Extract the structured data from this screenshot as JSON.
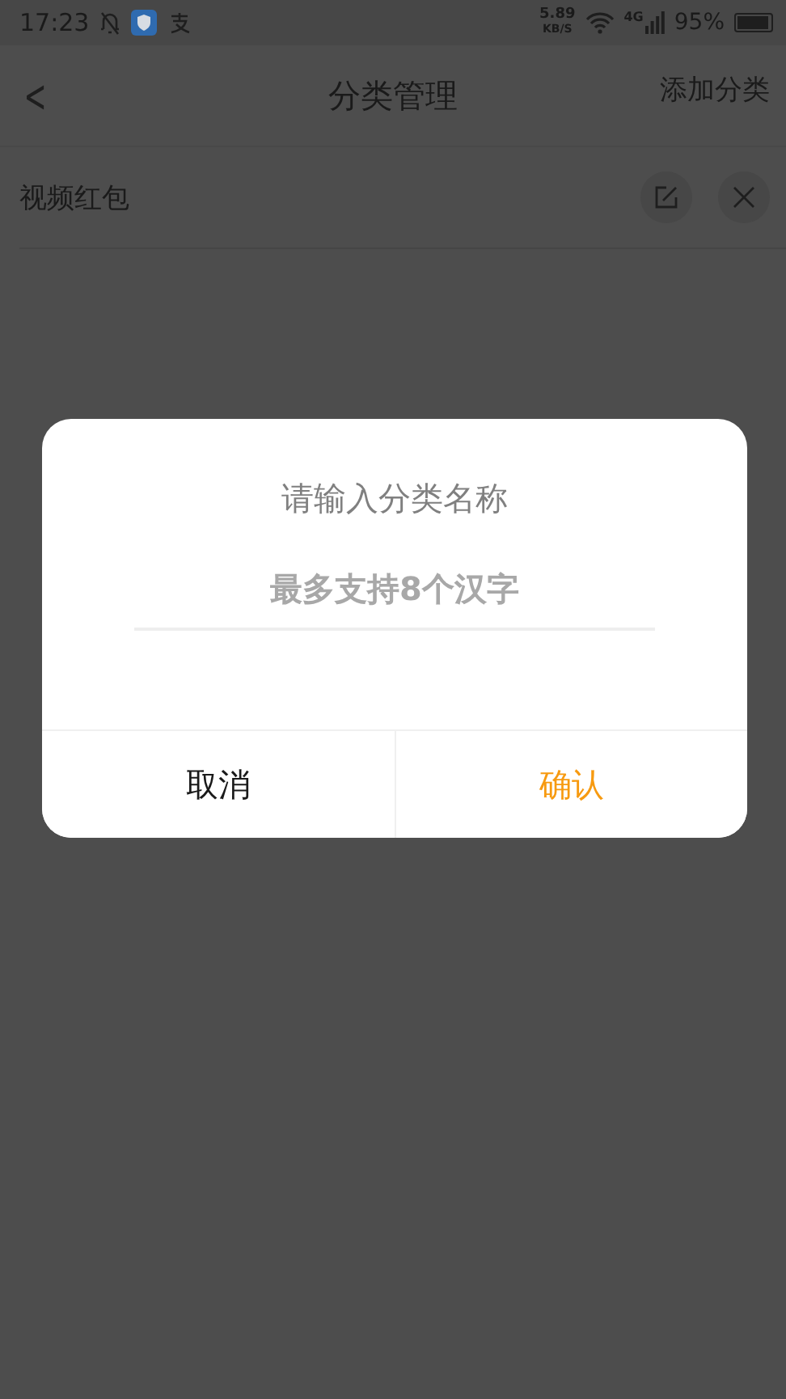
{
  "status_bar": {
    "time": "17:23",
    "speed_value": "5.89",
    "speed_unit": "KB/S",
    "network": "4G",
    "battery": "95%"
  },
  "header": {
    "back": "<",
    "title": "分类管理",
    "action": "添加分类"
  },
  "categories": [
    {
      "name": "视频红包"
    }
  ],
  "dialog": {
    "title": "请输入分类名称",
    "placeholder": "最多支持8个汉字",
    "buttons": [
      {
        "label": "取消",
        "kind": "cancel"
      },
      {
        "label": "确认",
        "kind": "confirm"
      }
    ]
  }
}
